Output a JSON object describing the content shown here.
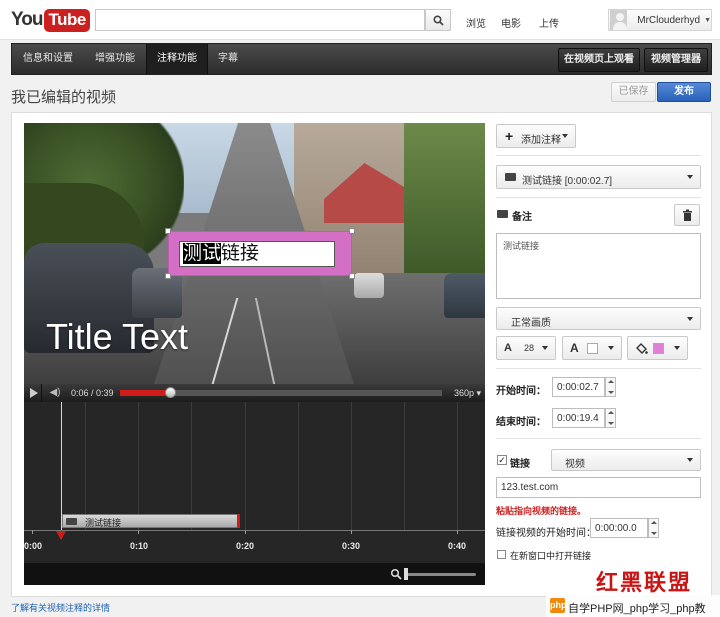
{
  "header": {
    "logo_you": "You",
    "logo_tube": "Tube",
    "search_placeholder": "",
    "links": [
      "浏览",
      "电影",
      "上传"
    ],
    "username": "MrClouderhyd"
  },
  "navbar": {
    "tabs": [
      {
        "label": "信息和设置",
        "active": false
      },
      {
        "label": "增强功能",
        "active": false
      },
      {
        "label": "注释功能",
        "active": true
      },
      {
        "label": "字幕",
        "active": false
      }
    ],
    "view_on_page": "在视频页上观看",
    "video_manager": "视频管理器"
  },
  "page": {
    "title": "我已编辑的视频",
    "saved": "已保存",
    "publish": "发布"
  },
  "video": {
    "overlay_title": "Title Text",
    "annotation_selected": "测试",
    "annotation_rest": "链接",
    "time": "0:06 / 0:39",
    "progress_fraction": 0.154,
    "quality": "360p"
  },
  "timeline": {
    "annotation_label": "测试链接",
    "ticks": [
      "0:00",
      "0:10",
      "0:20",
      "0:30",
      "0:40"
    ]
  },
  "editor": {
    "add_annotation": "添加注释",
    "annotation_select": "测试链接 [0:00:02.7]",
    "type_label": "备注",
    "text_content": "测试链接",
    "style_select": "正常画质",
    "font_size": "28",
    "text_color": "#ffffff",
    "bg_color": "#e07fd6",
    "start_label": "开始时间：",
    "start_value": "0:00:02.7",
    "end_label": "结束时间：",
    "end_value": "0:00:19.4",
    "link_label": "链接",
    "link_type": "视频",
    "link_url": "123.test.com",
    "link_hint": "粘贴指向视频的链接。",
    "link_start_label": "链接视频的开始时间：",
    "link_start_value": "0:00:00.0",
    "new_window_label": "在新窗口中打开链接"
  },
  "footer": {
    "learn_more": "了解有关视频注释的详情"
  },
  "watermark": {
    "big": "红黑联盟",
    "logo": "php",
    "text": "自学PHP网_php学习_php教"
  }
}
